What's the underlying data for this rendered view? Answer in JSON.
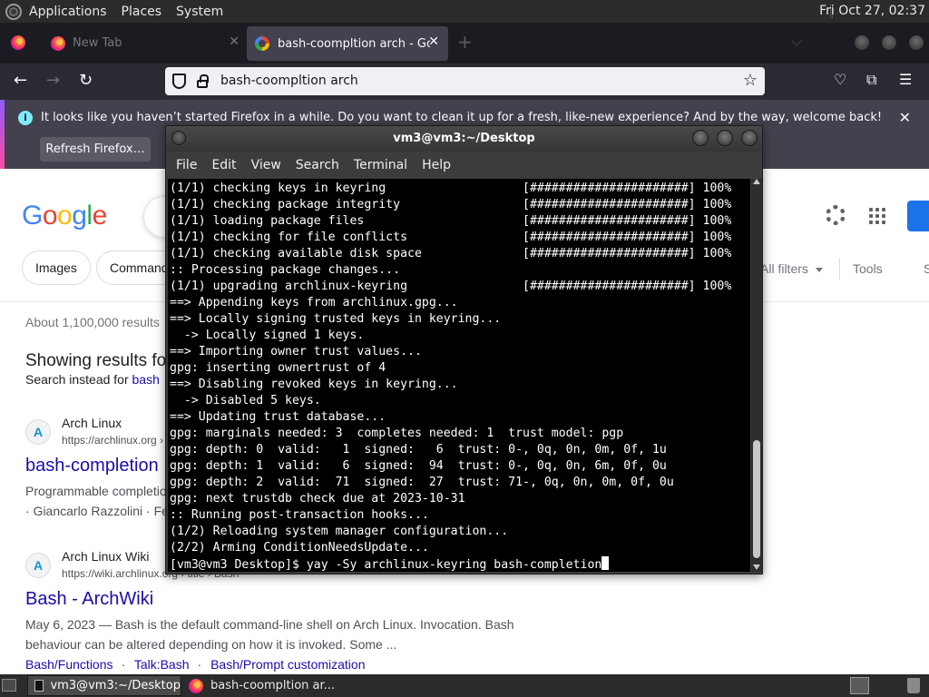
{
  "top_panel": {
    "menus": [
      "Applications",
      "Places",
      "System"
    ],
    "clock": "Fri Oct 27, 02:37"
  },
  "browser": {
    "tabs": [
      {
        "title": "New Tab",
        "active": false
      },
      {
        "title": "bash-coompltion arch - Goo",
        "active": true
      }
    ],
    "url": "bash-coompltion arch",
    "notification": {
      "text": "It looks like you haven’t started Firefox in a while. Do you want to clean it up for a fresh, like-new experience? And by the way, welcome back!",
      "button": "Refresh Firefox…",
      "info_icon": "i",
      "close": "✕"
    }
  },
  "google": {
    "logo_letters": [
      {
        "ch": "G",
        "color": "#4285f4"
      },
      {
        "ch": "o",
        "color": "#ea4335"
      },
      {
        "ch": "o",
        "color": "#fbbc05"
      },
      {
        "ch": "g",
        "color": "#4285f4"
      },
      {
        "ch": "l",
        "color": "#34a853"
      },
      {
        "ch": "e",
        "color": "#ea4335"
      }
    ],
    "chips": [
      "Images",
      "Command"
    ],
    "all_filters": "All filters",
    "tools": "Tools",
    "overflow": "S",
    "result_stats": "About 1,100,000 results",
    "showing_results": "Showing results for",
    "search_instead_prefix": "Search instead for ",
    "search_instead_link": "bash",
    "results": [
      {
        "favicon": "A",
        "site": "Arch Linux",
        "url": "https://archlinux.org ›",
        "title": "bash-completion",
        "snippet_lines": [
          "Programmable completio",
          "· Giancarlo Razzolini · Fe"
        ]
      },
      {
        "favicon": "A",
        "site": "Arch Linux Wiki",
        "url": "https://wiki.archlinux.org › title › Bash",
        "title": "Bash - ArchWiki",
        "snippet_lines": [
          "May 6, 2023 — Bash is the default command-line shell on Arch Linux. Invocation. Bash",
          "behaviour can be altered depending on how it is invoked. Some ..."
        ],
        "links": [
          "Bash/Functions",
          "Talk:Bash",
          "Bash/Prompt customization"
        ]
      }
    ]
  },
  "terminal": {
    "title": "vm3@vm3:~/Desktop",
    "menu": [
      "File",
      "Edit",
      "View",
      "Search",
      "Terminal",
      "Help"
    ],
    "lines": [
      "(1/1) checking keys in keyring                   [######################] 100%",
      "(1/1) checking package integrity                 [######################] 100%",
      "(1/1) loading package files                      [######################] 100%",
      "(1/1) checking for file conflicts                [######################] 100%",
      "(1/1) checking available disk space              [######################] 100%",
      ":: Processing package changes...",
      "(1/1) upgrading archlinux-keyring                [######################] 100%",
      "==> Appending keys from archlinux.gpg...",
      "==> Locally signing trusted keys in keyring...",
      "  -> Locally signed 1 keys.",
      "==> Importing owner trust values...",
      "gpg: inserting ownertrust of 4",
      "==> Disabling revoked keys in keyring...",
      "  -> Disabled 5 keys.",
      "==> Updating trust database...",
      "gpg: marginals needed: 3  completes needed: 1  trust model: pgp",
      "gpg: depth: 0  valid:   1  signed:   6  trust: 0-, 0q, 0n, 0m, 0f, 1u",
      "gpg: depth: 1  valid:   6  signed:  94  trust: 0-, 0q, 0n, 6m, 0f, 0u",
      "gpg: depth: 2  valid:  71  signed:  27  trust: 71-, 0q, 0n, 0m, 0f, 0u",
      "gpg: next trustdb check due at 2023-10-31",
      ":: Running post-transaction hooks...",
      "(1/2) Reloading system manager configuration...",
      "(2/2) Arming ConditionNeedsUpdate...",
      "[vm3@vm3 Desktop]$ yay -Sy archlinux-keyring bash-completion"
    ]
  },
  "taskbar": {
    "tasks": [
      "vm3@vm3:~/Desktop",
      "bash-coompltion ar..."
    ]
  }
}
